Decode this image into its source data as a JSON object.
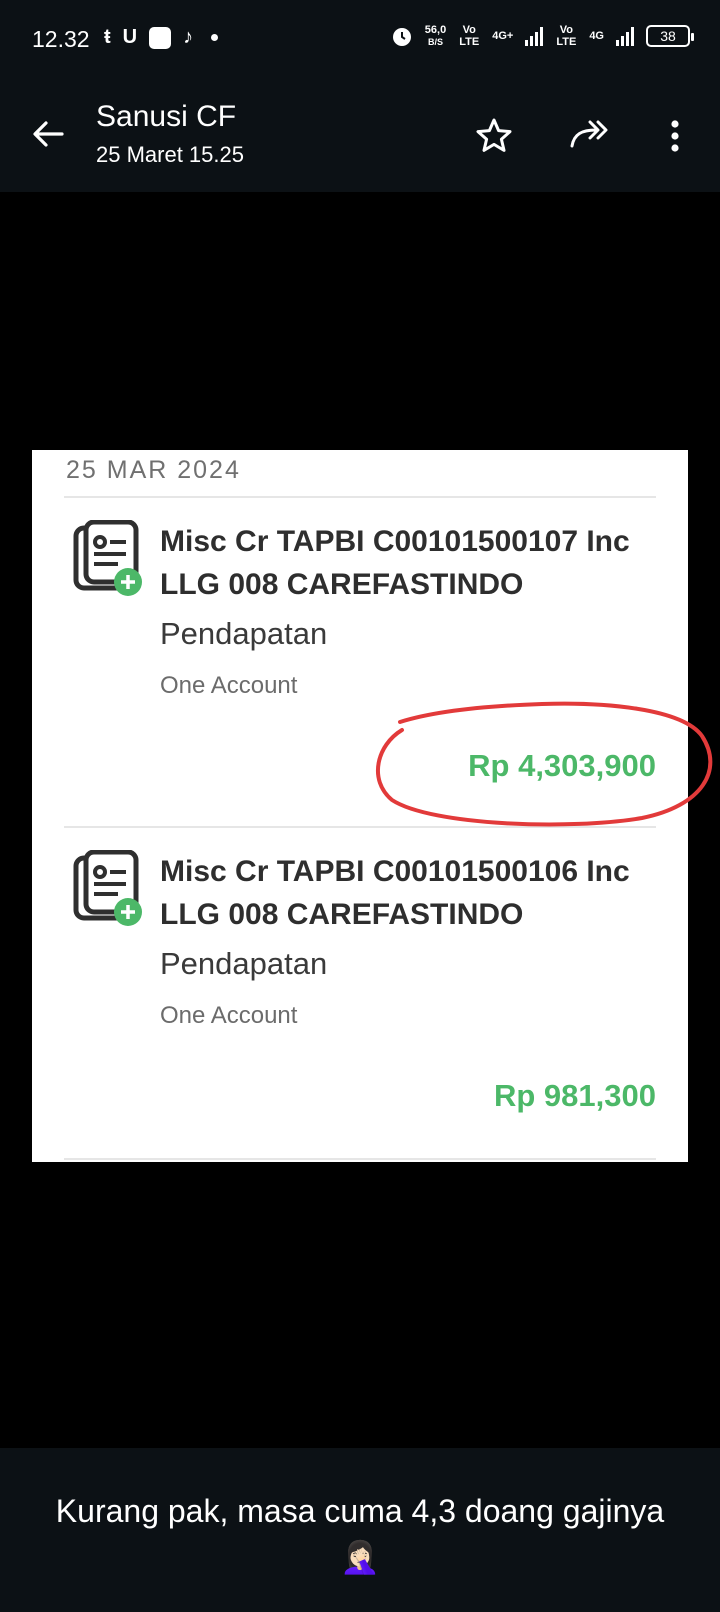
{
  "status_bar": {
    "time": "12.32",
    "net_speed": "56,0",
    "net_unit": "B/S",
    "volte1": "Vo LTE",
    "net_type1": "4G+",
    "volte2": "Vo LTE",
    "net_type2": "4G",
    "battery": "38"
  },
  "header": {
    "sender": "Sanusi CF",
    "timestamp": "25 Maret 15.25"
  },
  "statement": {
    "date_header": "25 MAR 2024",
    "transactions": [
      {
        "title": "Misc Cr TAPBI C00101500107 Inc LLG 008 CAREFASTINDO",
        "category": "Pendapatan",
        "account": "One Account",
        "amount": "Rp 4,303,900"
      },
      {
        "title": "Misc Cr TAPBI C00101500106 Inc LLG 008 CAREFASTINDO",
        "category": "Pendapatan",
        "account": "One Account",
        "amount": "Rp 981,300"
      }
    ]
  },
  "caption": "Kurang pak, masa cuma 4,3 doang gajinya🤦🏻‍♀️",
  "colors": {
    "bar_bg": "#0c1115",
    "amount_green": "#4cb868",
    "annotation_red": "#e23a3a"
  }
}
